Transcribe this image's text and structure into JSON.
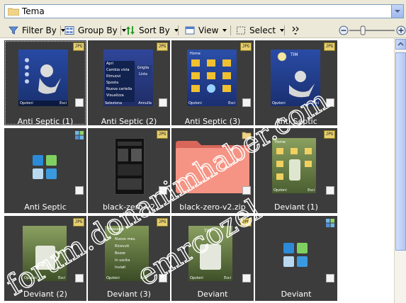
{
  "address": {
    "text": "Tema"
  },
  "toolbar": {
    "filter_label": "Filter By",
    "group_label": "Group By",
    "sort_label": "Sort By",
    "view_label": "View",
    "select_label": "Select",
    "zoom_level": 0.27
  },
  "files": [
    {
      "name": "Anti Septic (1)",
      "type": "jpg"
    },
    {
      "name": "Anti Septic (2)",
      "type": "jpg"
    },
    {
      "name": "Anti Septic (3)",
      "type": "jpg"
    },
    {
      "name": "Anti Septic",
      "type": "jpg"
    },
    {
      "name": "Anti Septic",
      "type": "app"
    },
    {
      "name": "black-zero-v2",
      "type": "jpg"
    },
    {
      "name": "black-zero-v2.zip",
      "type": "folder"
    },
    {
      "name": "Deviant (1)",
      "type": "jpg"
    },
    {
      "name": "Deviant (2)",
      "type": "jpg"
    },
    {
      "name": "Deviant (3)",
      "type": "jpg"
    },
    {
      "name": "Deviant",
      "type": "jpg"
    },
    {
      "name": "Deviant",
      "type": "app"
    }
  ],
  "thumb_text": {
    "menu_items": [
      "Apri",
      "Cambia vista",
      "Rimuovi",
      "Sposta",
      "Nuova cartella",
      "Visualizza"
    ],
    "submenu_items": [
      "Griglia",
      "Lista"
    ],
    "left_soft": "Opzioni",
    "right_soft": "Esci",
    "select_soft": "Seleziona",
    "cancel_soft": "Annulla",
    "title_home": "Home",
    "operator": "TIM",
    "msg_label": "Messaggi",
    "new_msg": "Nuovo mes.",
    "received": "Ricevuti",
    "drafts": "Bozze",
    "outbox": "In uscita",
    "sent": "Inviati",
    "badge": "JPG"
  },
  "watermark": {
    "line1": "forum.donanimhaber.com",
    "line2": "emrcozel"
  },
  "colors": {
    "tile_bg": "#3c3c3c",
    "jpg_badge": "#e8d070",
    "folder": "#f28b7a",
    "xp_blue": "#3166d6"
  }
}
